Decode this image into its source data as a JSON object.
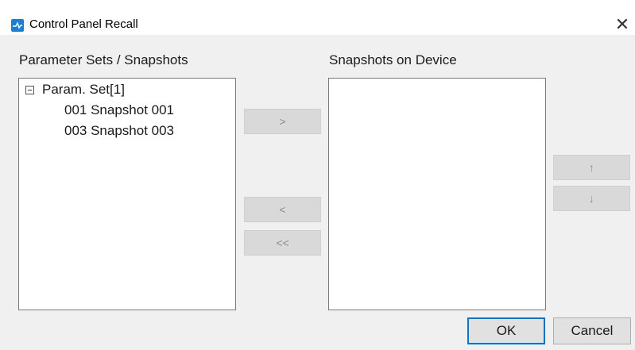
{
  "window": {
    "title": "Control Panel Recall",
    "close_glyph": "✕",
    "icon": "app-logo-icon",
    "icon_color": "#1b7fd6"
  },
  "left_panel": {
    "label": "Parameter Sets / Snapshots",
    "tree": {
      "parent_label": "Param. Set[1]",
      "children": [
        {
          "label": "001 Snapshot 001"
        },
        {
          "label": "003 Snapshot 003"
        }
      ]
    }
  },
  "right_panel": {
    "label": "Snapshots on Device"
  },
  "transfer_buttons": {
    "add": ">",
    "remove": "<",
    "remove_all": "<<"
  },
  "order_buttons": {
    "up": "↑",
    "down": "↓"
  },
  "footer": {
    "ok": "OK",
    "cancel": "Cancel"
  }
}
